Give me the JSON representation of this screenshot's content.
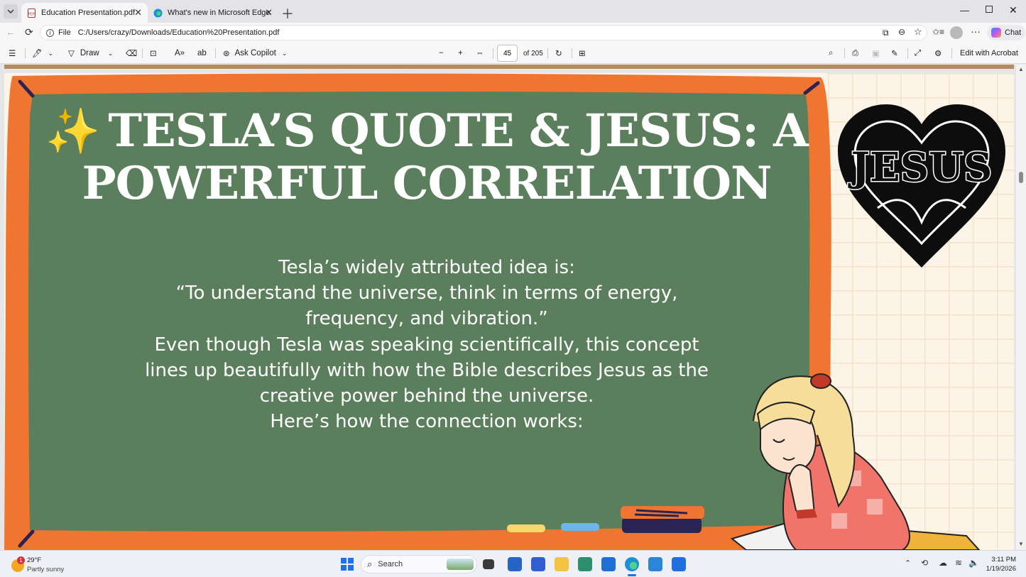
{
  "tabs": [
    {
      "label": "Education Presentation.pdf",
      "active": true
    },
    {
      "label": "What's new in Microsoft Edge",
      "active": false
    }
  ],
  "address": {
    "scheme": "File",
    "url": "C:/Users/crazy/Downloads/Education%20Presentation.pdf"
  },
  "browser": {
    "chat_label": "Chat"
  },
  "pdf_toolbar": {
    "draw_label": "Draw",
    "ask_copilot_label": "Ask Copilot",
    "page_number": "45",
    "page_total": "of 205",
    "edit_acrobat_label": "Edit with Acrobat"
  },
  "slide": {
    "title_line1": "TESLA’S QUOTE & JESUS: A",
    "title_line2": "POWERFUL CORRELATION",
    "title_emoji": "✨",
    "logo_text": "JESUS",
    "body_lines": [
      "Tesla’s widely attributed idea is:",
      "“To understand the universe, think in terms of energy,",
      "frequency, and vibration.”",
      "Even though Tesla was speaking scientifically, this concept",
      "lines up beautifully with how the Bible describes Jesus as the",
      "creative power behind the universe.",
      "Here’s how the connection works:"
    ],
    "colors": {
      "board_green": "#5b7f5c",
      "frame_orange": "#f07530",
      "background": "#fdf4e8"
    }
  },
  "taskbar": {
    "weather_temp": "29°F",
    "weather_desc": "Partly sunny",
    "weather_badge": "1",
    "search_placeholder": "Search",
    "time": "3:11 PM",
    "date": "1/19/2026"
  }
}
